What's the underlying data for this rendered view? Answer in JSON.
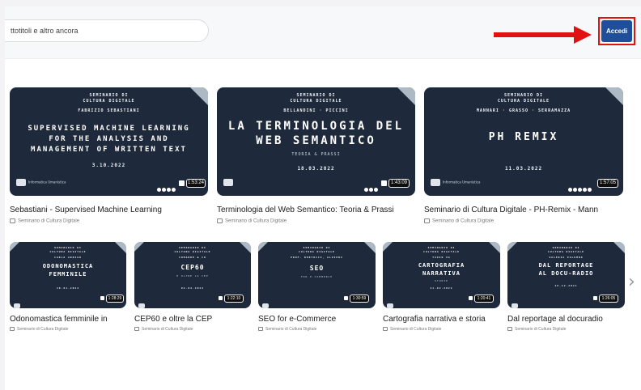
{
  "header": {
    "search_placeholder": "ttotitoli e altro ancora",
    "login_label": "Accedi",
    "colors": {
      "accent_button": "#1f4f9a",
      "annotation": "#e31212"
    }
  },
  "row1": [
    {
      "thumb": {
        "kicker1": "SEMINARIO DI",
        "kicker2": "CULTURA DIGITALE",
        "names": "FABRIZIO SEBASTIANI",
        "title_lines": [
          "SUPERVISED MACHINE LEARNING",
          "FOR THE ANALYSIS AND",
          "MANAGEMENT OF WRITTEN TEXT"
        ],
        "subtitle": "",
        "date": "3.10.2022",
        "logo_text": "Informatica Umanistica",
        "duration": "1:53:24"
      },
      "title": "Sebastiani - Supervised Machine Learning",
      "channel": "Seminario di Cultura Digitale"
    },
    {
      "thumb": {
        "kicker1": "SEMINARIO DI",
        "kicker2": "CULTURA DIGITALE",
        "names": "BELLANDINI · PICCINI",
        "title_lines": [
          "LA TERMINOLOGIA DEL",
          "WEB SEMANTICO"
        ],
        "subtitle": "TEORIA & PRASSI",
        "date": "18.03.2022",
        "logo_text": "",
        "duration": "1:43:09"
      },
      "title": "Terminologia del Web Semantico: Teoria & Prassi",
      "channel": "Seminario di Cultura Digitale"
    },
    {
      "thumb": {
        "kicker1": "SEMINARIO DI",
        "kicker2": "CULTURA DIGITALE",
        "names": "MANNARI · GRASSO · SERRAMAZZA",
        "title_lines": [
          "PH REMIX"
        ],
        "subtitle": "",
        "date": "11.03.2022",
        "logo_text": "Informatica Umanistica",
        "duration": "1:57:05"
      },
      "title": "Seminario di Cultura Digitale - PH-Remix - Mann",
      "channel": "Seminario di Cultura Digitale"
    }
  ],
  "row2": [
    {
      "thumb": {
        "kicker1": "SEMINARIO DI",
        "kicker2": "CULTURA DIGITALE",
        "names": "CARLO ARRIGO",
        "title_lines": [
          "ODONOMASTICA",
          "FEMMINILE"
        ],
        "subtitle": "",
        "date": "20.01.2022",
        "duration": "1:28:29"
      },
      "title": "Odonomastica femminile in",
      "channel": "Seminario di Cultura Digitale"
    },
    {
      "thumb": {
        "kicker1": "SEMINARIO DI",
        "kicker2": "CULTURA DIGITALE",
        "names": "COMANDE & CO",
        "title_lines": [
          "CEP60"
        ],
        "subtitle": "E OLTRE LA CEP",
        "date": "02.02.2022",
        "duration": "1:22:10"
      },
      "title": "CEP60 e oltre la CEP",
      "channel": "Seminario di Cultura Digitale"
    },
    {
      "thumb": {
        "kicker1": "SEMINARIO DI",
        "kicker2": "CULTURA DIGITALE",
        "names": "PROF. BERTOCCI, ALVIERI",
        "title_lines": [
          "SEO"
        ],
        "subtitle": "FOR E-COMMERCE",
        "date": "",
        "duration": "1:30:59"
      },
      "title": "SEO for e-Commerce",
      "channel": "Seminario di Cultura Digitale"
    },
    {
      "thumb": {
        "kicker1": "SEMINARIO DI",
        "kicker2": "CULTURA DIGITALE",
        "names": "TIZIO VG",
        "title_lines": [
          "CARTOGRAFIA",
          "NARRATIVA"
        ],
        "subtitle": "STORIE",
        "date": "21.02.2022",
        "duration": "1:20:41"
      },
      "title": "Cartografia narrativa e storia",
      "channel": "Seminario di Cultura Digitale"
    },
    {
      "thumb": {
        "kicker1": "SEMINARIO DI",
        "kicker2": "CULTURA DIGITALE",
        "names": "VALERIA PALUMBO",
        "title_lines": [
          "DAL REPORTAGE",
          "AL DOCU-RADIO"
        ],
        "subtitle": "",
        "date": "16.12.2021",
        "duration": "1:26:05"
      },
      "title": "Dal reportage al docuradio",
      "channel": "Seminario di Cultura Digitale"
    }
  ]
}
